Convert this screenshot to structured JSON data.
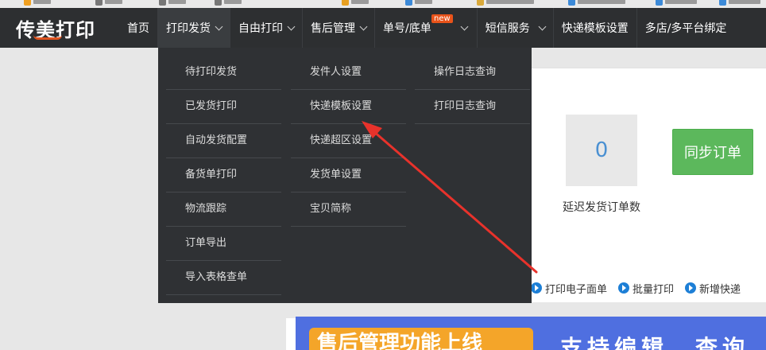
{
  "header": {
    "logo": "传美打印",
    "nav": [
      {
        "label": "首页",
        "chevron": false
      },
      {
        "label": "打印发货",
        "chevron": true,
        "active": true
      },
      {
        "label": "自由打印",
        "chevron": true
      },
      {
        "label": "售后管理",
        "chevron": true
      },
      {
        "label": "单号/底单",
        "chevron": true,
        "badge": "new"
      },
      {
        "label": "短信服务",
        "chevron": true
      },
      {
        "label": "快递模板设置",
        "chevron": false
      },
      {
        "label": "多店/多平台绑定",
        "chevron": false
      }
    ]
  },
  "dropdown": {
    "columns": [
      [
        "待打印发货",
        "已发货打印",
        "自动发货配置",
        "备货单打印",
        "物流跟踪",
        "订单导出",
        "导入表格查单"
      ],
      [
        "发件人设置",
        "快递模板设置",
        "快递超区设置",
        "发货单设置",
        "宝贝简称"
      ],
      [
        "操作日志查询",
        "打印日志查询"
      ]
    ]
  },
  "stats": {
    "delayed_count": "0",
    "delayed_label": "延迟发货订单数"
  },
  "sync_button": "同步订单",
  "quick_links": [
    "打印电子面单",
    "批量打印",
    "新增快递"
  ],
  "banner": {
    "tag": "售后管理功能上线",
    "text": "支持编辑、查询"
  },
  "colors": {
    "header_bg": "#2d2f31",
    "dropdown_bg": "#2f3134",
    "sync_green": "#5cb85c",
    "count_blue": "#4a90d2",
    "arrow_red": "#e8322b",
    "badge_orange": "#e8531a",
    "banner_blue": "#4f6fe0"
  }
}
